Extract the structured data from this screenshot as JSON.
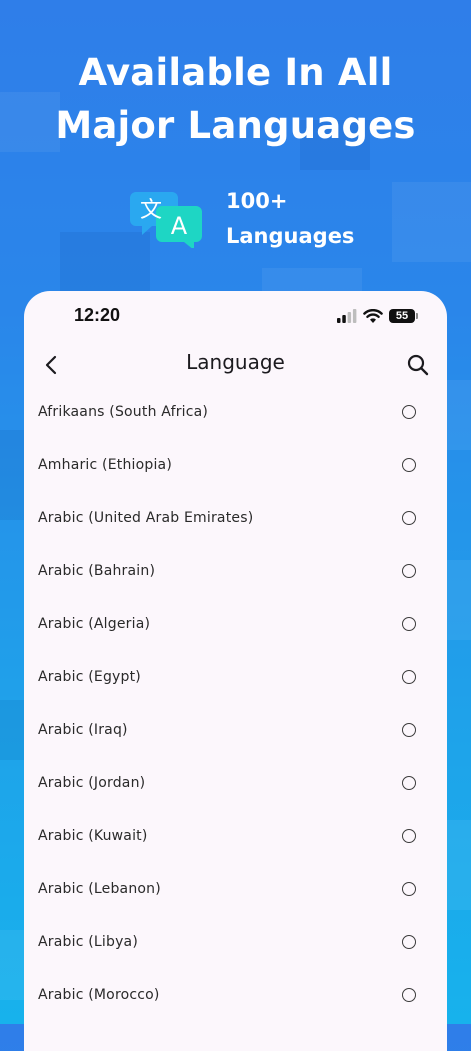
{
  "promo": {
    "headline_line1": "Available In All",
    "headline_line2": "Major Languages",
    "badge_glyph_left": "文",
    "badge_glyph_right": "A",
    "count_line1": "100+",
    "count_line2": "Languages"
  },
  "status_bar": {
    "time": "12:20",
    "battery": "55"
  },
  "app_bar": {
    "title": "Language"
  },
  "languages": [
    {
      "name": "Afrikaans (South Africa)",
      "selected": false
    },
    {
      "name": "Amharic (Ethiopia)",
      "selected": false
    },
    {
      "name": "Arabic (United Arab Emirates)",
      "selected": false
    },
    {
      "name": "Arabic (Bahrain)",
      "selected": false
    },
    {
      "name": "Arabic (Algeria)",
      "selected": false
    },
    {
      "name": "Arabic (Egypt)",
      "selected": false
    },
    {
      "name": "Arabic (Iraq)",
      "selected": false
    },
    {
      "name": "Arabic (Jordan)",
      "selected": false
    },
    {
      "name": "Arabic (Kuwait)",
      "selected": false
    },
    {
      "name": "Arabic (Lebanon)",
      "selected": false
    },
    {
      "name": "Arabic (Libya)",
      "selected": false
    },
    {
      "name": "Arabic (Morocco)",
      "selected": false
    }
  ],
  "colors": {
    "background_top": "#2f7ee9",
    "background_bottom": "#17b2ec",
    "sheet": "#fcf7fc",
    "badge_blue": "#2aa8f0",
    "badge_teal": "#1ed6c4"
  }
}
